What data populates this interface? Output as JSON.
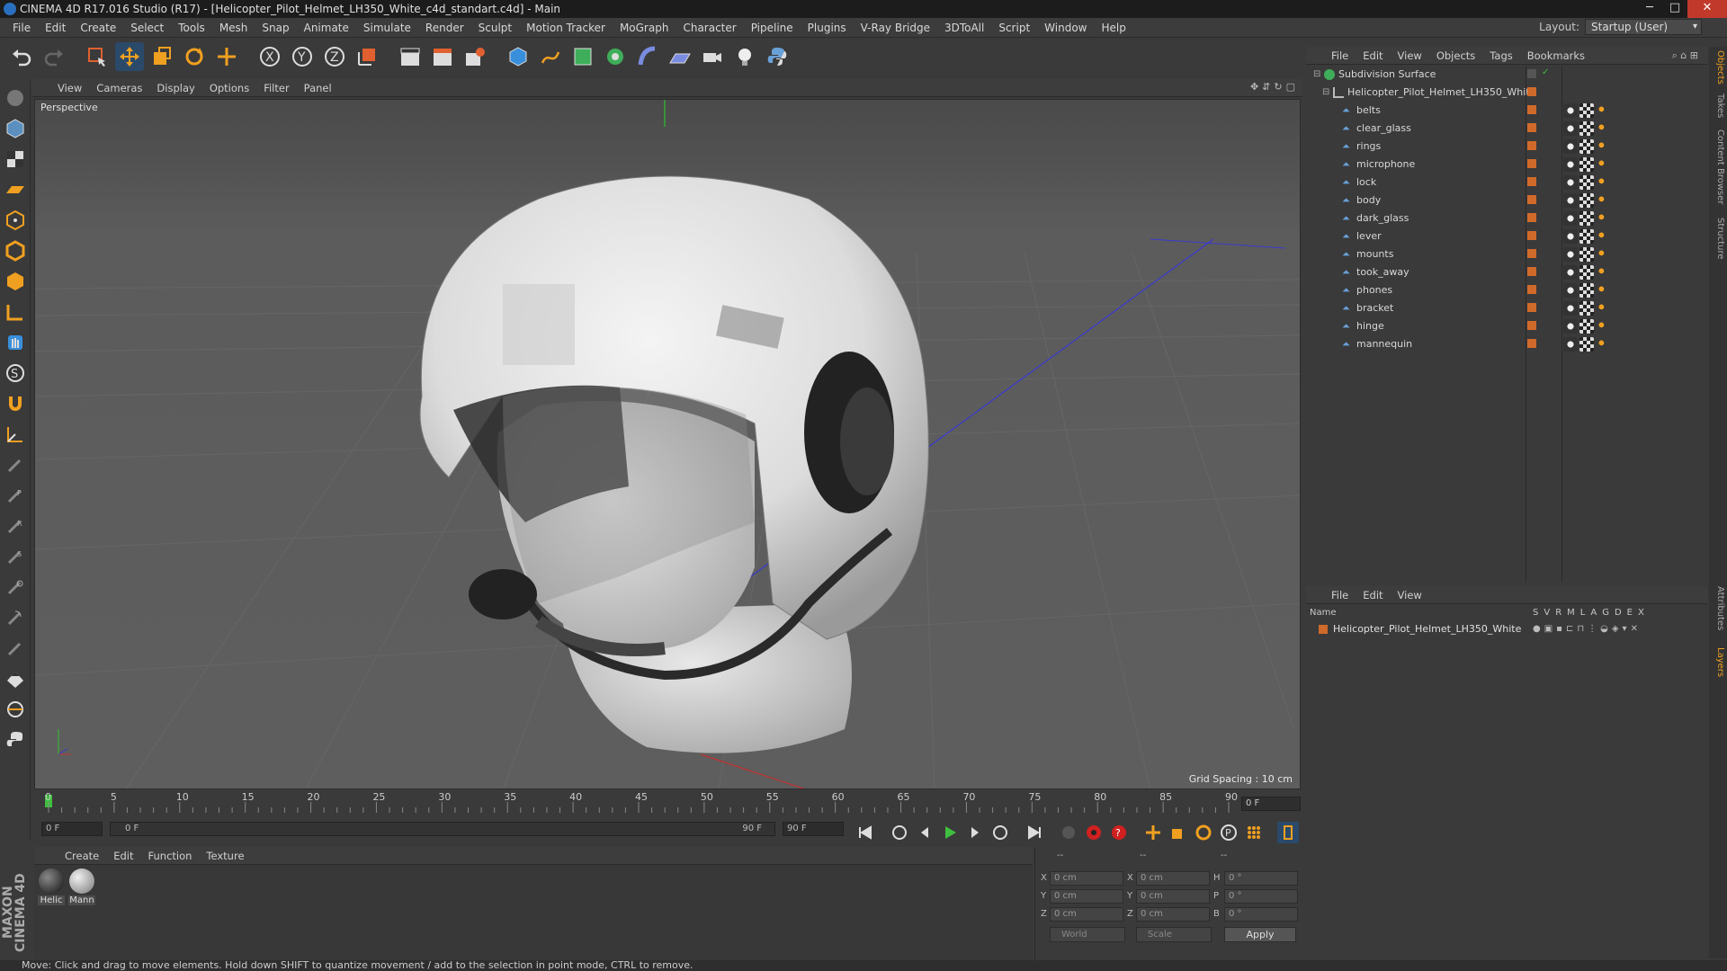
{
  "window": {
    "title": "CINEMA 4D R17.016 Studio (R17) - [Helicopter_Pilot_Helmet_LH350_White_c4d_standart.c4d] - Main"
  },
  "menu": [
    "File",
    "Edit",
    "Create",
    "Select",
    "Tools",
    "Mesh",
    "Snap",
    "Animate",
    "Simulate",
    "Render",
    "Sculpt",
    "Motion Tracker",
    "MoGraph",
    "Character",
    "Pipeline",
    "Plugins",
    "V-Ray Bridge",
    "3DToAll",
    "Script",
    "Window",
    "Help"
  ],
  "layout": {
    "label": "Layout:",
    "value": "Startup (User)"
  },
  "viewport": {
    "menu": [
      "View",
      "Cameras",
      "Display",
      "Options",
      "Filter",
      "Panel"
    ],
    "camera_label": "Perspective",
    "grid_spacing": "Grid Spacing : 10 cm"
  },
  "timeline": {
    "ticks": [
      "0",
      "5",
      "10",
      "15",
      "20",
      "25",
      "30",
      "35",
      "40",
      "45",
      "50",
      "55",
      "60",
      "65",
      "70",
      "75",
      "80",
      "85",
      "90"
    ],
    "current_frame": "0 F",
    "start_field": "0 F",
    "range_start": "0 F",
    "range_end": "90 F",
    "end_field": "90 F"
  },
  "material_manager": {
    "menu": [
      "Create",
      "Edit",
      "Function",
      "Texture"
    ],
    "materials": [
      {
        "name": "Helic",
        "color": "#222222"
      },
      {
        "name": "Mann",
        "color": "#bdbdbd"
      }
    ]
  },
  "coordinates": {
    "header": [
      "--",
      "--",
      "--"
    ],
    "rows": [
      {
        "axis": "X",
        "pos": "0 cm",
        "axis2": "X",
        "size": "0 cm",
        "rot_label": "H",
        "rot": "0 °"
      },
      {
        "axis": "Y",
        "pos": "0 cm",
        "axis2": "Y",
        "size": "0 cm",
        "rot_label": "P",
        "rot": "0 °"
      },
      {
        "axis": "Z",
        "pos": "0 cm",
        "axis2": "Z",
        "size": "0 cm",
        "rot_label": "B",
        "rot": "0 °"
      }
    ],
    "mode1": "World",
    "mode2": "Scale",
    "apply": "Apply"
  },
  "status": "Move: Click and drag to move elements. Hold down SHIFT to quantize movement / add to the selection in point mode, CTRL to remove.",
  "object_manager": {
    "menu": [
      "File",
      "Edit",
      "View",
      "Objects",
      "Tags",
      "Bookmarks"
    ],
    "root": "Subdivision Surface",
    "group": "Helicopter_Pilot_Helmet_LH350_White",
    "children": [
      "belts",
      "clear_glass",
      "rings",
      "microphone",
      "lock",
      "body",
      "dark_glass",
      "lever",
      "mounts",
      "took_away",
      "phones",
      "bracket",
      "hinge",
      "mannequin"
    ]
  },
  "layer_manager": {
    "menu": [
      "File",
      "Edit",
      "View"
    ],
    "header_name": "Name",
    "header_cols": [
      "S",
      "V",
      "R",
      "M",
      "L",
      "A",
      "G",
      "D",
      "E",
      "X"
    ],
    "layer": "Helicopter_Pilot_Helmet_LH350_White"
  },
  "right_tabs": [
    "Objects",
    "Takes",
    "Content Browser",
    "Structure",
    "Attributes",
    "Layers"
  ],
  "logo": "MAXON CINEMA 4D",
  "colors": {
    "accent": "#2a6fbf",
    "layer_orange": "#d06a2a",
    "play_green": "#3fbf3f"
  }
}
